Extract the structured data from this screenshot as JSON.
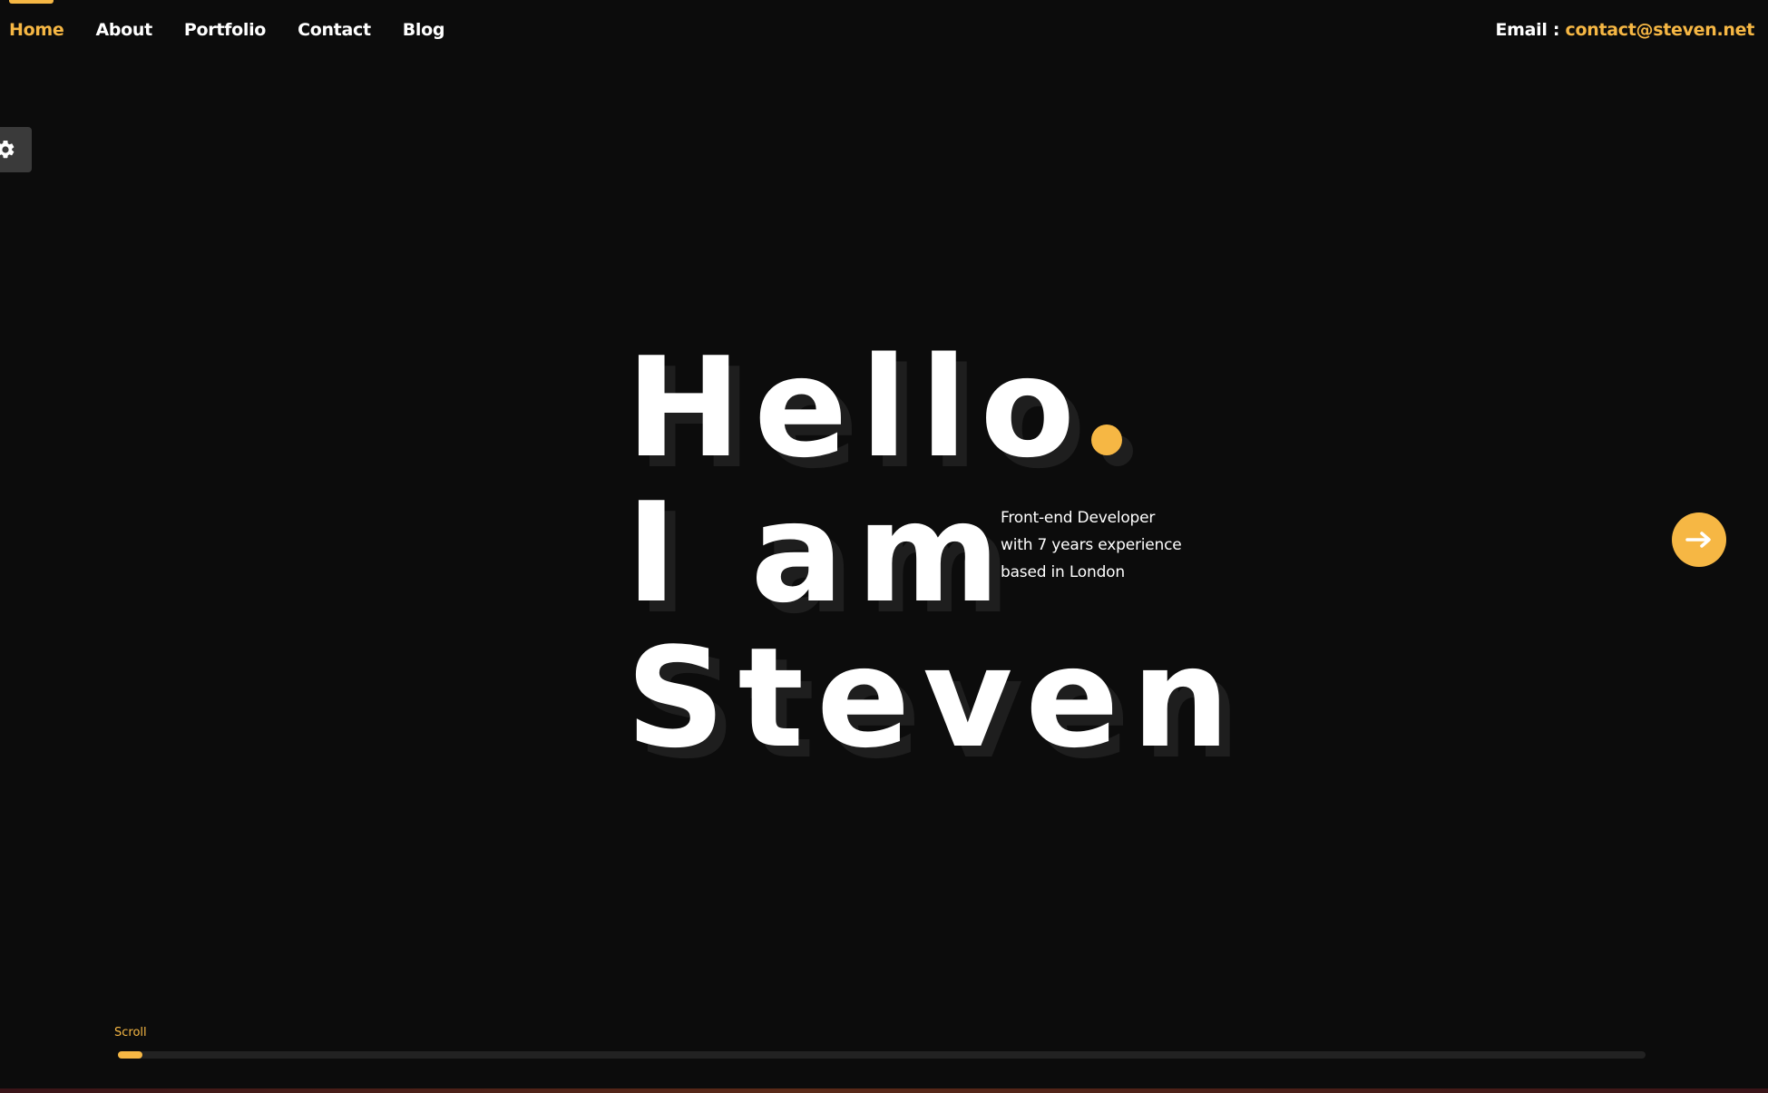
{
  "nav": {
    "items": [
      {
        "label": "Home",
        "active": true
      },
      {
        "label": "About",
        "active": false
      },
      {
        "label": "Portfolio",
        "active": false
      },
      {
        "label": "Contact",
        "active": false
      },
      {
        "label": "Blog",
        "active": false
      }
    ]
  },
  "header": {
    "email_label": "Email :",
    "email_value": "contact@steven.net"
  },
  "settings": {
    "icon": "gear-icon"
  },
  "hero": {
    "line1": "Hello",
    "line2": "I am",
    "line3": "Steven",
    "tagline": [
      "Front-end Developer",
      "with 7 years experience",
      "based in London"
    ]
  },
  "next_button": {
    "icon": "arrow-right-icon"
  },
  "scroll": {
    "label": "Scroll",
    "progress": 0.016
  },
  "colors": {
    "accent": "#f6b744",
    "background": "#0c0c0c",
    "text": "#ffffff"
  }
}
